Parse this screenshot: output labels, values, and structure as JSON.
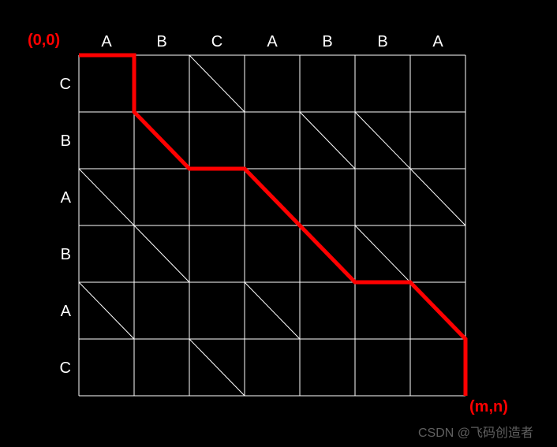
{
  "labels": {
    "origin": "(0,0)",
    "end": "(m,n)",
    "cols": [
      "A",
      "B",
      "C",
      "A",
      "B",
      "B",
      "A"
    ],
    "rows": [
      "C",
      "B",
      "A",
      "B",
      "A",
      "C"
    ]
  },
  "watermark": "CSDN @飞码创造者",
  "chart_data": {
    "type": "diagram",
    "description": "LCS edit graph / grid",
    "string1": [
      "A",
      "B",
      "C",
      "A",
      "B",
      "B",
      "A"
    ],
    "string2": [
      "C",
      "B",
      "A",
      "B",
      "A",
      "C"
    ],
    "grid_origin": [
      0,
      0
    ],
    "grid_end": [
      "m",
      "n"
    ],
    "grid_cols": 7,
    "grid_rows": 6,
    "diagonals": [
      [
        2,
        0,
        3,
        1
      ],
      [
        1,
        1,
        2,
        2
      ],
      [
        4,
        1,
        5,
        2
      ],
      [
        5,
        1,
        6,
        2
      ],
      [
        0,
        2,
        1,
        3
      ],
      [
        3,
        2,
        4,
        3
      ],
      [
        6,
        2,
        7,
        3
      ],
      [
        1,
        3,
        2,
        4
      ],
      [
        4,
        3,
        5,
        4
      ],
      [
        5,
        3,
        6,
        4
      ],
      [
        0,
        4,
        1,
        5
      ],
      [
        3,
        4,
        4,
        5
      ],
      [
        6,
        4,
        7,
        5
      ],
      [
        2,
        5,
        3,
        6
      ]
    ],
    "path": [
      [
        0,
        0
      ],
      [
        1,
        0
      ],
      [
        1,
        1
      ],
      [
        2,
        2
      ],
      [
        3,
        2
      ],
      [
        4,
        3
      ],
      [
        5,
        4
      ],
      [
        6,
        4
      ],
      [
        7,
        5
      ],
      [
        7,
        6
      ]
    ]
  }
}
